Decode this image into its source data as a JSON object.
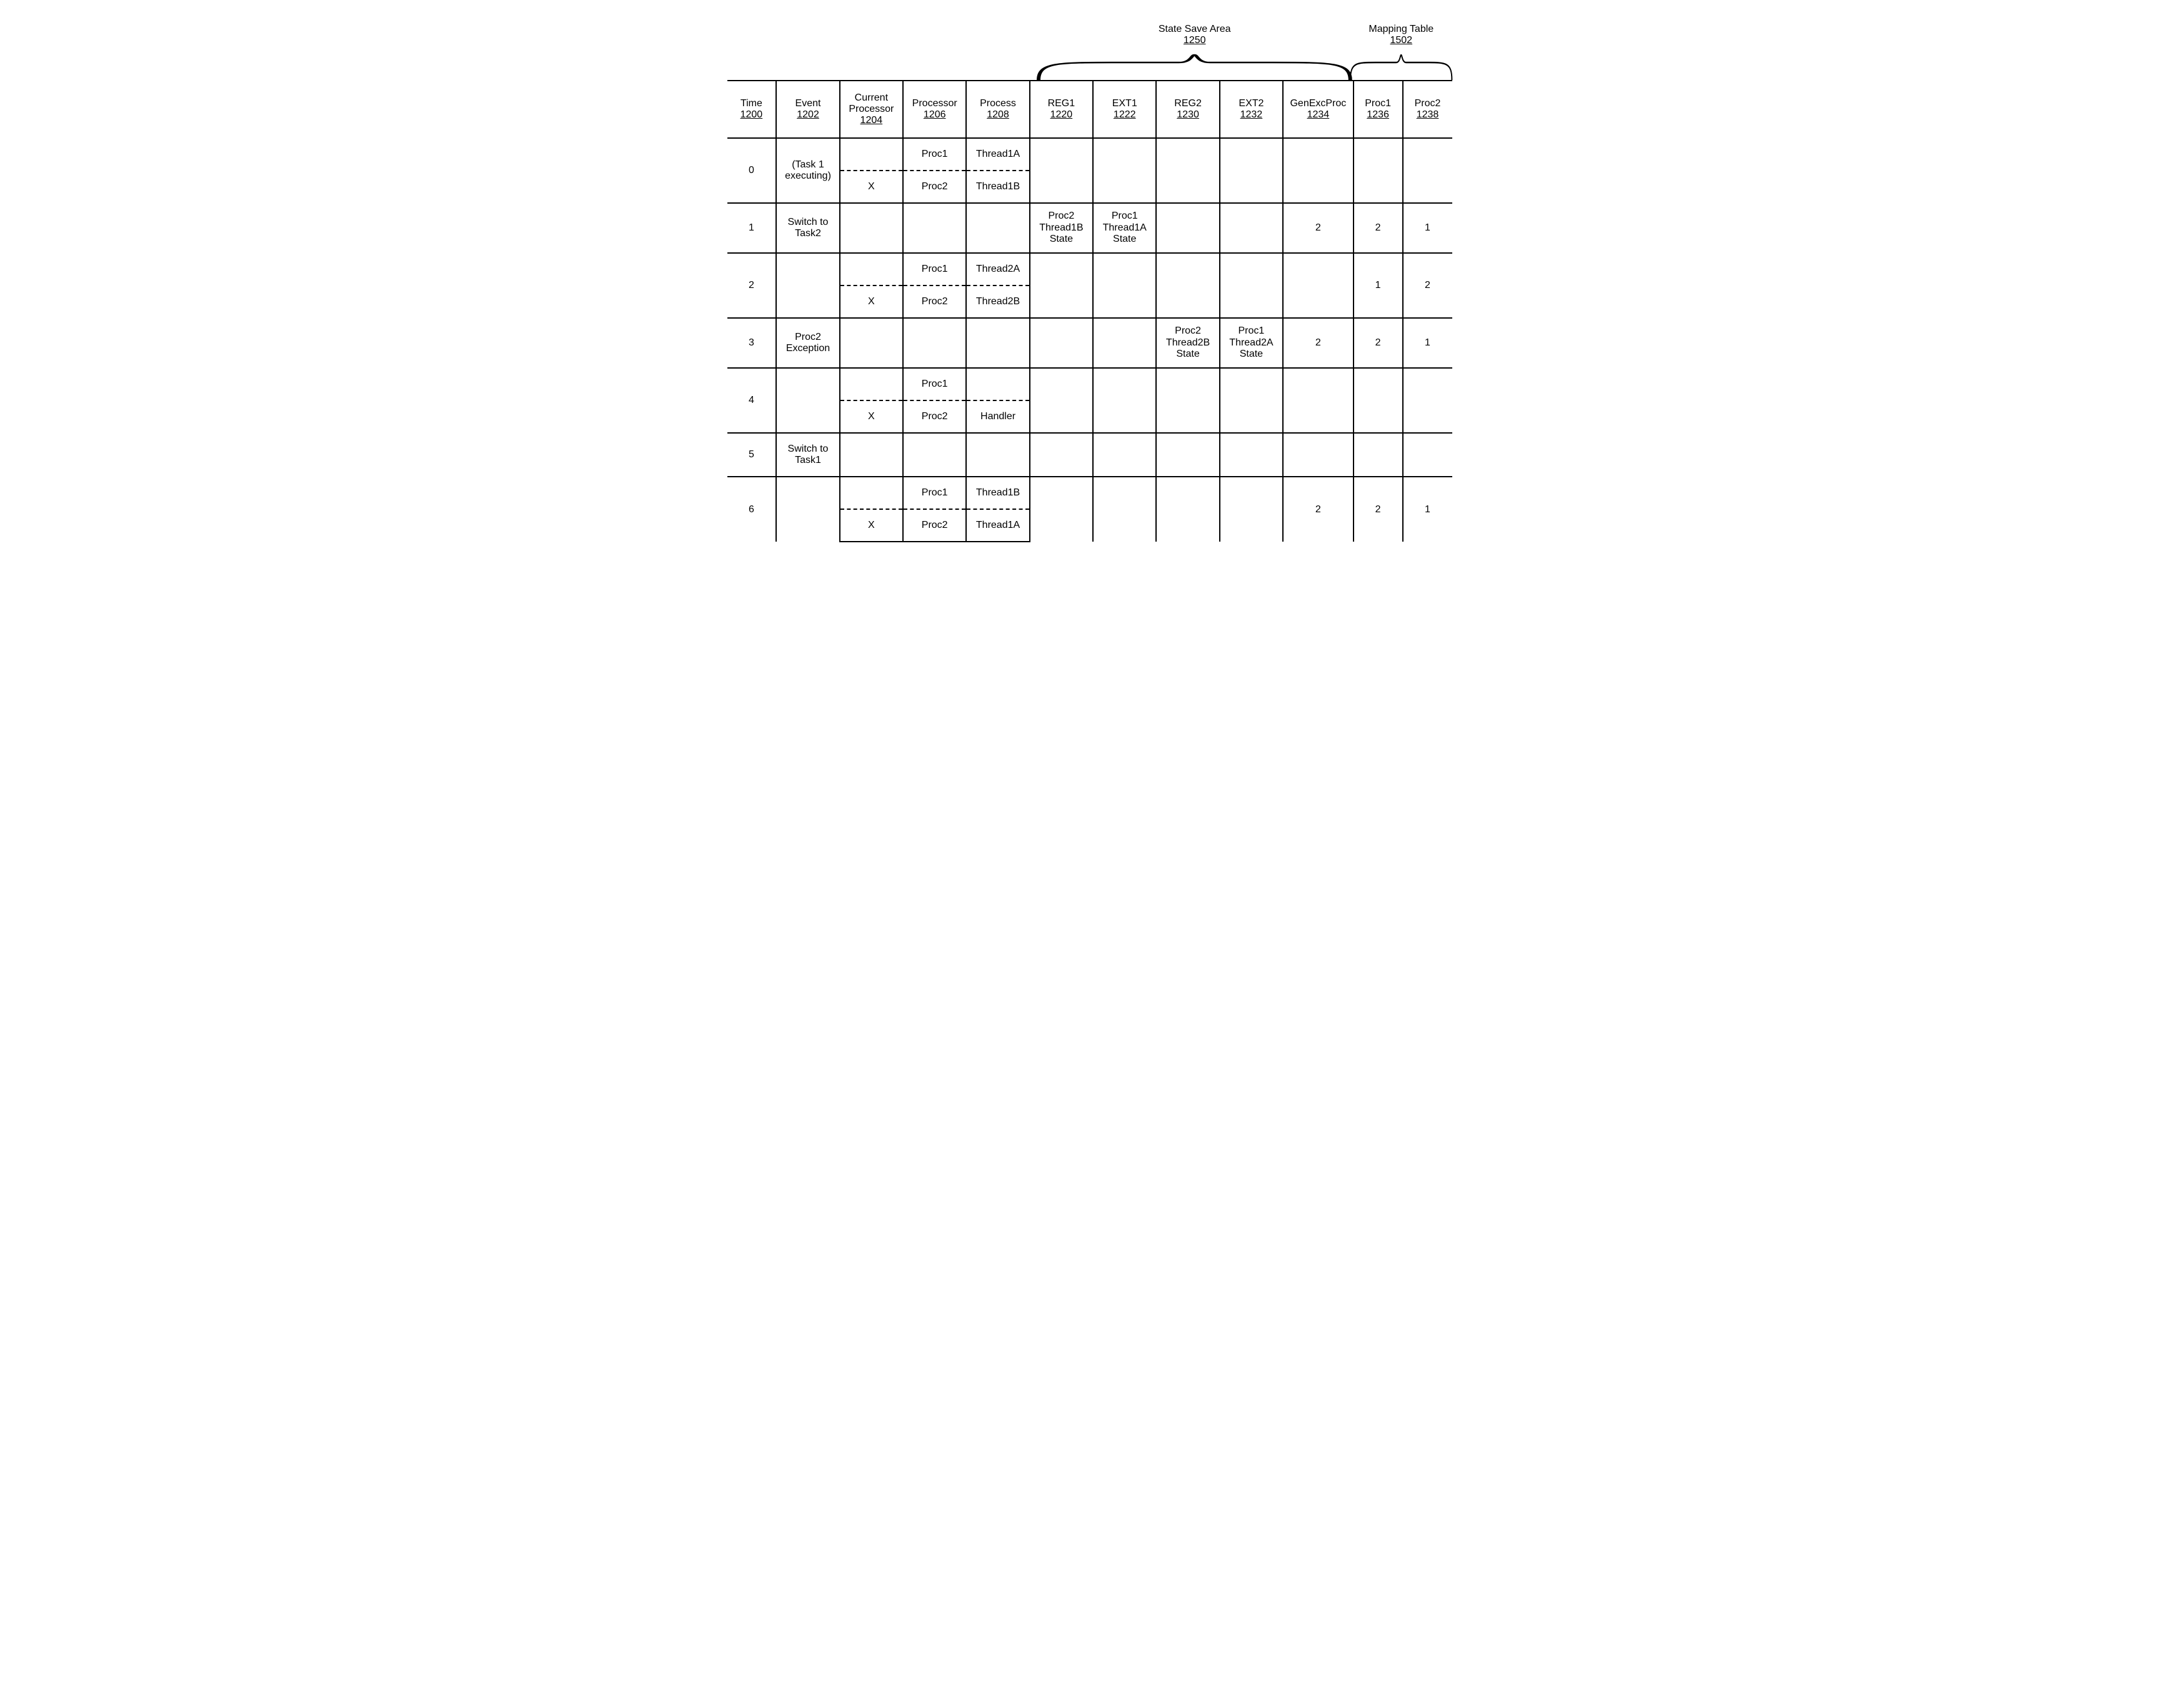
{
  "braces": {
    "state_save": {
      "label": "State Save Area",
      "num": "1250"
    },
    "mapping": {
      "label": "Mapping Table",
      "num": "1502"
    }
  },
  "headers": [
    {
      "name": "Time",
      "num": "1200"
    },
    {
      "name": "Event",
      "num": "1202"
    },
    {
      "name": "Current Processor",
      "num": "1204"
    },
    {
      "name": "Processor",
      "num": "1206"
    },
    {
      "name": "Process",
      "num": "1208"
    },
    {
      "name": "REG1",
      "num": "1220"
    },
    {
      "name": "EXT1",
      "num": "1222"
    },
    {
      "name": "REG2",
      "num": "1230"
    },
    {
      "name": "EXT2",
      "num": "1232"
    },
    {
      "name": "GenExcProc",
      "num": "1234"
    },
    {
      "name": "Proc1",
      "num": "1236"
    },
    {
      "name": "Proc2",
      "num": "1238"
    }
  ],
  "rows": {
    "r0": {
      "time": "0",
      "event": "(Task 1 executing)",
      "sub": [
        {
          "cur": "",
          "proc": "Proc1",
          "process": "Thread1A"
        },
        {
          "cur": "X",
          "proc": "Proc2",
          "process": "Thread1B"
        }
      ]
    },
    "r1": {
      "time": "1",
      "event": "Switch to Task2",
      "reg1": "Proc2 Thread1B State",
      "ext1": "Proc1 Thread1A State",
      "gen": "2",
      "p1": "2",
      "p2": "1"
    },
    "r2": {
      "time": "2",
      "sub": [
        {
          "cur": "",
          "proc": "Proc1",
          "process": "Thread2A"
        },
        {
          "cur": "X",
          "proc": "Proc2",
          "process": "Thread2B"
        }
      ],
      "p1": "1",
      "p2": "2"
    },
    "r3": {
      "time": "3",
      "event": "Proc2 Exception",
      "reg2": "Proc2 Thread2B State",
      "ext2": "Proc1 Thread2A State",
      "gen": "2",
      "p1": "2",
      "p2": "1"
    },
    "r4": {
      "time": "4",
      "sub": [
        {
          "cur": "",
          "proc": "Proc1",
          "process": ""
        },
        {
          "cur": "X",
          "proc": "Proc2",
          "process": "Handler"
        }
      ]
    },
    "r5": {
      "time": "5",
      "event": "Switch to Task1"
    },
    "r6": {
      "time": "6",
      "sub": [
        {
          "cur": "",
          "proc": "Proc1",
          "process": "Thread1B"
        },
        {
          "cur": "X",
          "proc": "Proc2",
          "process": "Thread1A"
        }
      ],
      "gen": "2",
      "p1": "2",
      "p2": "1"
    }
  }
}
